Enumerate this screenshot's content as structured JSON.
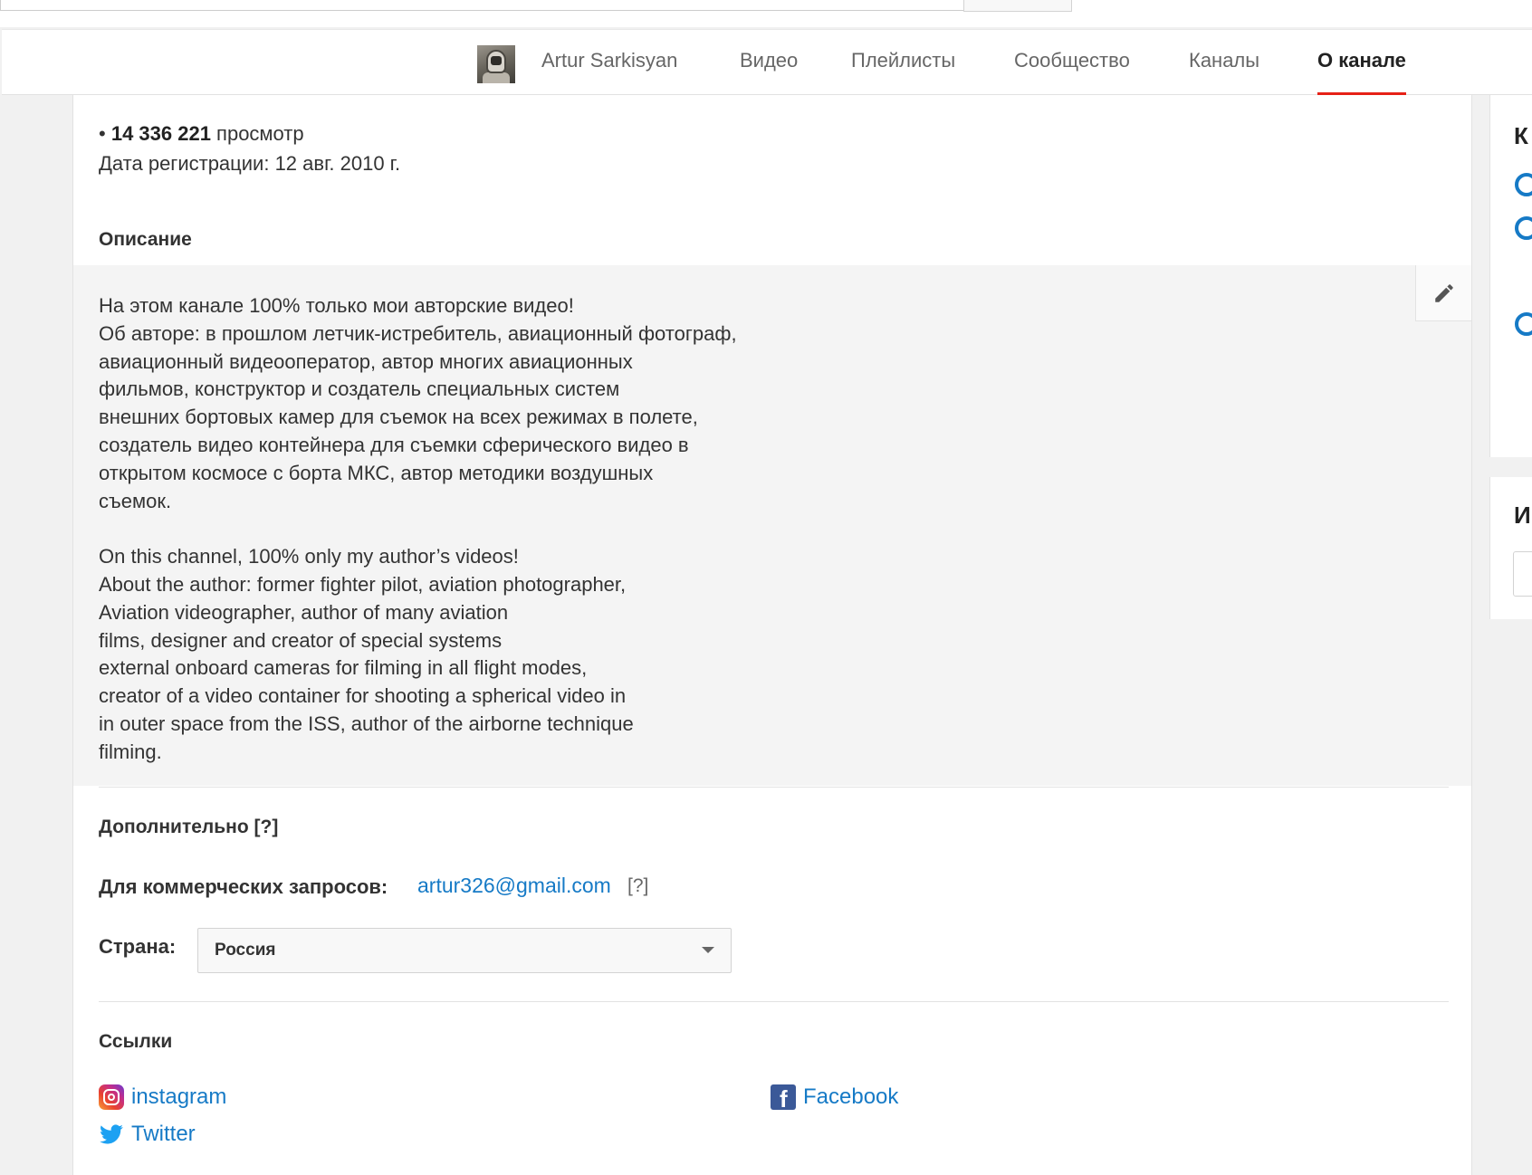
{
  "nav": {
    "channel_name": "Artur Sarkisyan",
    "tabs": [
      {
        "label": "Видео"
      },
      {
        "label": "Плейлисты"
      },
      {
        "label": "Сообщество"
      },
      {
        "label": "Каналы"
      },
      {
        "label": "О канале",
        "active": true
      }
    ],
    "active_underline_color": "#e62117"
  },
  "about": {
    "stats_bullet": "• ",
    "views_count": "14 336 221",
    "views_suffix": " просмотр",
    "registration": "Дата регистрации: 12 авг. 2010 г.",
    "description_title": "Описание",
    "description_text": "На этом канале 100% только мои авторские видео!\nОб авторе: в прошлом летчик-истребитель, авиационный фотограф,\nавиационный видеооператор, автор многих авиационных\nфильмов, конструктор и создатель специальных систем\nвнешних бортовых камер для съемок на всех режимах в полете,\nсоздатель видео контейнера для съемки сферического видео в\nоткрытом космосе с борта МКС, автор методики воздушных\nсъемок.\n\nOn this channel, 100% only my author’s videos!\nAbout the author: former fighter pilot, aviation photographer,\nAviation videographer, author of many aviation\nfilms, designer and creator of special systems\nexternal onboard cameras for filming in all flight modes,\ncreator of a video container for shooting a spherical video in\nin outer space from the ISS, author of the airborne technique\nfilming.",
    "edit_icon": "pencil-icon",
    "additional_title": "Дополнительно [?]",
    "business_label": "Для коммерческих запросов:",
    "business_email": "artur326@gmail.com",
    "business_help": "[?]",
    "country_label": "Страна:",
    "country_value": "Россия",
    "links_title": "Ссылки",
    "links": [
      {
        "label": "instagram",
        "icon": "instagram-icon"
      },
      {
        "label": "Facebook",
        "icon": "facebook-icon"
      },
      {
        "label": "Twitter",
        "icon": "twitter-icon"
      }
    ],
    "link_color": "#167ac6"
  },
  "sidebar": {
    "card1_letter": "К",
    "card2_letter": "И"
  }
}
